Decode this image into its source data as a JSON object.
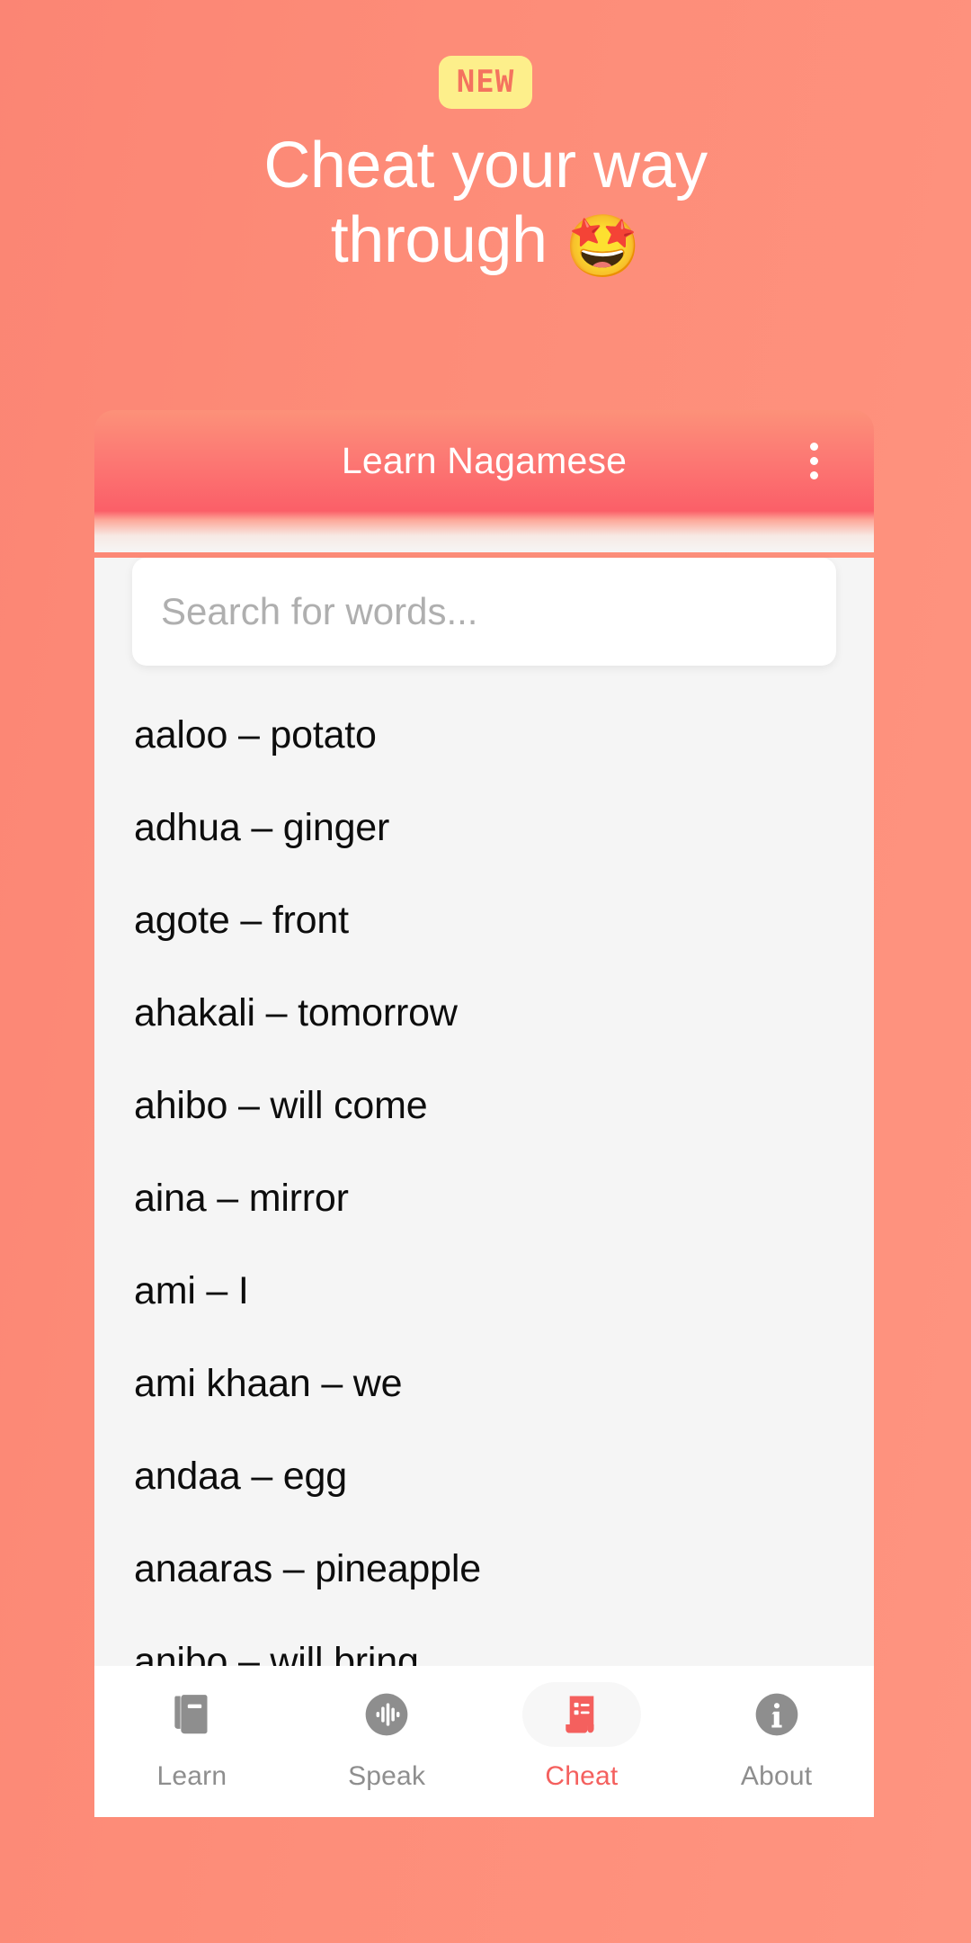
{
  "promo": {
    "badge": "NEW",
    "headline_line1": "Cheat your way",
    "headline_line2": "through",
    "headline_emoji": "🤩"
  },
  "appbar": {
    "title": "Learn Nagamese",
    "overflow_icon": "more-vert-icon"
  },
  "search": {
    "placeholder": "Search for words...",
    "value": ""
  },
  "word_list": [
    {
      "text": "aaloo – potato"
    },
    {
      "text": "adhua – ginger"
    },
    {
      "text": "agote – front"
    },
    {
      "text": "ahakali – tomorrow"
    },
    {
      "text": "ahibo – will come"
    },
    {
      "text": "aina – mirror"
    },
    {
      "text": "ami – I"
    },
    {
      "text": "ami khaan – we"
    },
    {
      "text": "andaa – egg"
    },
    {
      "text": "anaaras – pineapple"
    },
    {
      "text": "anibo – will bring"
    }
  ],
  "bottom_nav": {
    "items": [
      {
        "label": "Learn",
        "icon": "books-icon",
        "active": false
      },
      {
        "label": "Speak",
        "icon": "waveform-icon",
        "active": false
      },
      {
        "label": "Cheat",
        "icon": "cheatsheet-icon",
        "active": true
      },
      {
        "label": "About",
        "icon": "info-icon",
        "active": false
      }
    ]
  },
  "colors": {
    "background_coral": "#FD8C78",
    "badge_yellow": "#FDEF8B",
    "badge_text": "#F4735F",
    "appbar_gradient_top": "#FC9179",
    "appbar_gradient_bottom": "#FB5F68",
    "active_accent": "#F4605E",
    "inactive_grey": "#8E8E8E",
    "list_background": "#F5F5F5",
    "word_text": "#0D0D0D",
    "placeholder_grey": "#AFAFAF"
  }
}
